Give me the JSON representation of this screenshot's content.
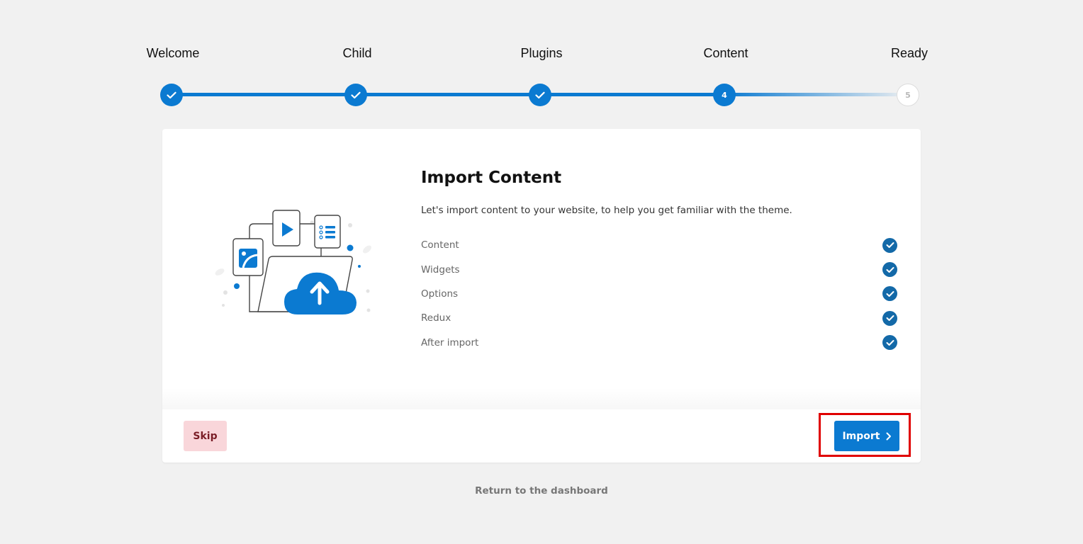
{
  "steps": [
    {
      "label": "Welcome",
      "status": "done"
    },
    {
      "label": "Child",
      "status": "done"
    },
    {
      "label": "Plugins",
      "status": "done"
    },
    {
      "label": "Content",
      "status": "current",
      "number": "4"
    },
    {
      "label": "Ready",
      "status": "pending",
      "number": "5"
    }
  ],
  "content": {
    "title": "Import Content",
    "subtitle": "Let's import content to your website, to help you get familiar with the theme.",
    "items": [
      {
        "label": "Content",
        "checked": true
      },
      {
        "label": "Widgets",
        "checked": true
      },
      {
        "label": "Options",
        "checked": true
      },
      {
        "label": "Redux",
        "checked": true
      },
      {
        "label": "After import",
        "checked": true
      }
    ]
  },
  "footer": {
    "skip_label": "Skip",
    "import_label": "Import"
  },
  "return_link": "Return to the dashboard",
  "colors": {
    "accent": "#0b7ad1",
    "check": "#1369a8",
    "skip_bg": "#f9d6da",
    "skip_text": "#7a1d26",
    "highlight": "#e00000"
  }
}
